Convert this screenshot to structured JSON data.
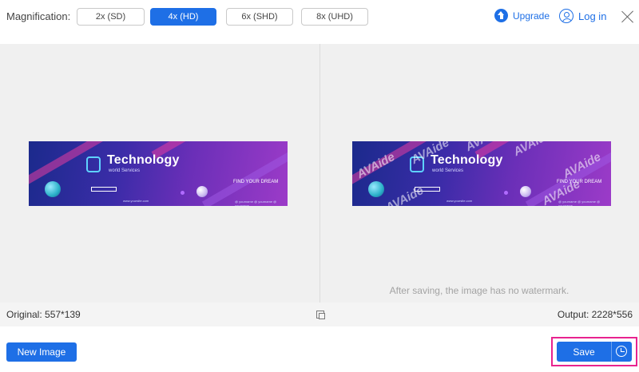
{
  "header": {
    "magnification_label": "Magnification:",
    "options": [
      {
        "label": "2x (SD)",
        "active": false
      },
      {
        "label": "4x (HD)",
        "active": true
      },
      {
        "label": "6x (SHD)",
        "active": false
      },
      {
        "label": "8x (UHD)",
        "active": false
      }
    ],
    "upgrade_label": "Upgrade",
    "login_label": "Log in"
  },
  "preview": {
    "banner": {
      "title": "Technology",
      "subtitle": "world Services",
      "tagline": "FIND YOUR DREAM",
      "website": "www.yoursite.com",
      "social": "@ yourname   @ yourname   @ yourname"
    },
    "watermark_text": "AVAide",
    "note": "After saving, the image has no watermark."
  },
  "info": {
    "original": "Original: 557*139",
    "output": "Output: 2228*556"
  },
  "footer": {
    "new_image_label": "New Image",
    "save_label": "Save"
  },
  "colors": {
    "accent": "#1e6fe6",
    "highlight": "#e8238f",
    "preview_bg": "#f0f0f0"
  }
}
